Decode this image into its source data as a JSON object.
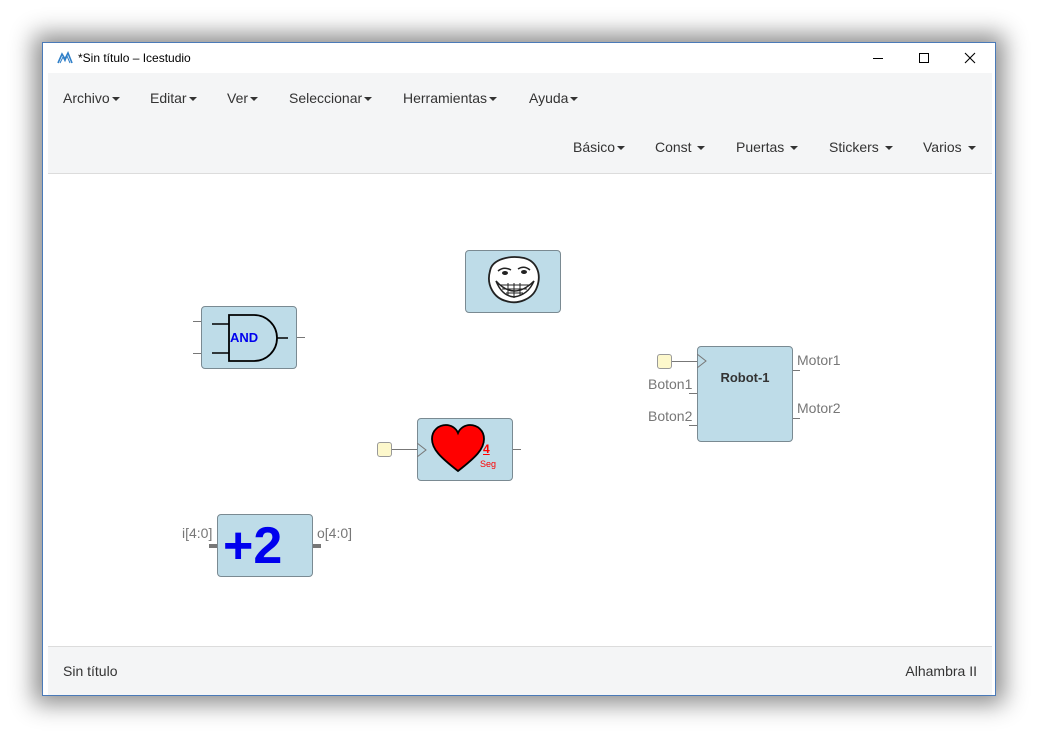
{
  "window": {
    "title": "*Sin título – Icestudio",
    "controls": {
      "minimize_icon": "minimize-icon",
      "maximize_icon": "maximize-icon",
      "close_icon": "close-icon"
    }
  },
  "menubar": {
    "items": [
      {
        "label": "Archivo"
      },
      {
        "label": "Editar"
      },
      {
        "label": "Ver"
      },
      {
        "label": "Seleccionar"
      },
      {
        "label": "Herramientas"
      },
      {
        "label": "Ayuda"
      }
    ]
  },
  "toolbar": {
    "items": [
      {
        "label": "Básico"
      },
      {
        "label": "Const"
      },
      {
        "label": "Puertas"
      },
      {
        "label": "Stickers"
      },
      {
        "label": "Varios"
      }
    ]
  },
  "canvas": {
    "and_block": {
      "label": "AND"
    },
    "troll_block": {
      "icon": "trollface-icon"
    },
    "heart_block": {
      "icon": "heart-icon",
      "number": "4",
      "unit": "Seg"
    },
    "robot_block": {
      "title": "Robot-1",
      "inputs": [
        "Boton1",
        "Boton2"
      ],
      "outputs": [
        "Motor1",
        "Motor2"
      ]
    },
    "plus_block": {
      "label": "+2",
      "input_label": "i[4:0]",
      "output_label": "o[4:0]"
    }
  },
  "statusbar": {
    "left": "Sin título",
    "right": "Alhambra II"
  },
  "colors": {
    "block_fill": "#bedce8",
    "input_fill": "#fdf8cc",
    "label_blue": "#0000ee",
    "heart_red": "#ff0000"
  }
}
